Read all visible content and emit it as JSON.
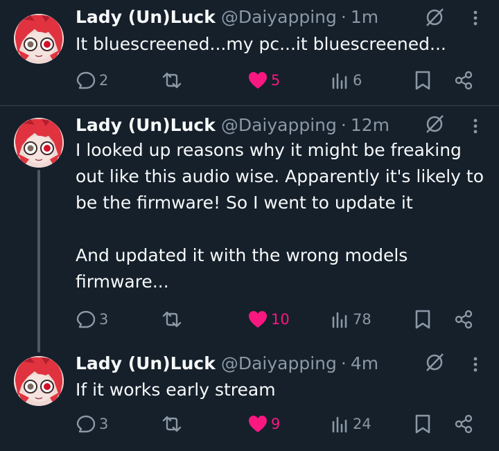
{
  "colors": {
    "background": "#15202b",
    "text": "#f7f9f9",
    "muted": "#8b98a5",
    "like": "#f91880",
    "divider": "#38444d"
  },
  "posts": [
    {
      "author": "Lady (Un)Luck",
      "handle": "@Daiyapping",
      "separator": "·",
      "time": "1m",
      "text": "It bluescreened...my pc...it bluescreened...",
      "replies": "2",
      "likes": "5",
      "views": "6"
    },
    {
      "author": "Lady (Un)Luck",
      "handle": "@Daiyapping",
      "separator": "·",
      "time": "12m",
      "text": "I looked up reasons why it might be freaking out like this audio wise. Apparently it's likely to be the firmware! So I went to update it\n\nAnd updated it with the wrong models firmware...",
      "replies": "3",
      "likes": "10",
      "views": "78"
    },
    {
      "author": "Lady (Un)Luck",
      "handle": "@Daiyapping",
      "separator": "·",
      "time": "4m",
      "text": "If it works early stream",
      "replies": "3",
      "likes": "9",
      "views": "24"
    }
  ],
  "icons": [
    "avatar",
    "grok-icon",
    "more-icon",
    "reply-icon",
    "repost-icon",
    "like-icon",
    "views-icon",
    "bookmark-icon",
    "share-icon"
  ]
}
